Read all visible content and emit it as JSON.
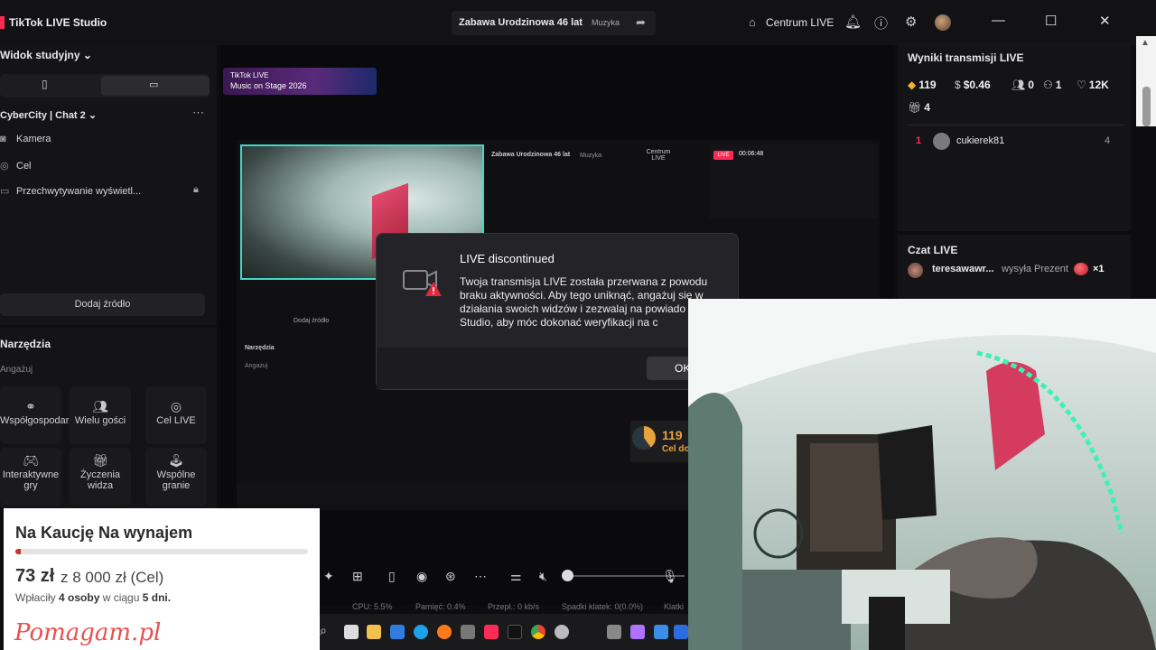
{
  "titlebar": {
    "app_title": "TikTok LIVE Studio",
    "stream_title": "Zabawa Urodzinowa 46 lat",
    "stream_category": "Muzyka",
    "centrum_live": "Centrum LIVE"
  },
  "left": {
    "studio_view": "Widok studyjny",
    "scene_name": "CyberCity | Chat 2",
    "sources": [
      {
        "label": "Kamera",
        "icon": "camera-icon"
      },
      {
        "label": "Cel",
        "icon": "target-icon"
      },
      {
        "label": "Przechwytywanie wyświetl...",
        "icon": "monitor-icon"
      }
    ],
    "add_source": "Dodaj źródło",
    "tools_title": "Narzędzia",
    "engage_label": "Angażuj",
    "tools": [
      {
        "label": "Współgospodarz",
        "icon": "link-icon"
      },
      {
        "label": "Wielu gości",
        "icon": "guests-icon"
      },
      {
        "label": "Cel LIVE",
        "icon": "target-icon"
      },
      {
        "label": "Interaktywne gry",
        "icon": "gamepad-icon"
      },
      {
        "label": "Życzenia widza",
        "icon": "gift-icon"
      },
      {
        "label": "Wspólne granie",
        "icon": "joystick-icon"
      }
    ]
  },
  "promo": {
    "line1": "TikTok LIVE",
    "line2": "Music on Stage 2026"
  },
  "nested": {
    "title": "Zabawa Urodzinowa 46 lat",
    "category": "Muzyka",
    "centrum": "Centrum LIVE",
    "timer": "00:06:48",
    "add_source": "Dodaj źródło",
    "tools": "Narzędzia",
    "engage": "Angażuj",
    "goal_value": "119",
    "goal_label": "Cel do"
  },
  "dialog": {
    "title": "LIVE discontinued",
    "body": "Twoja transmisja LIVE została przerwana z powodu braku aktywności. Aby tego uniknąć, angażuj się w działania swoich widzów i zezwalaj na powiado z LIVE Studio, aby móc dokonać weryfikacji na c",
    "ok": "OK"
  },
  "stats": {
    "cpu": "CPU: 5.5%",
    "memory": "Pamięć: 0.4%",
    "bitrate": "Przepł.: 0 kb/s",
    "frames": "Spadki klatek: 0(0.0%)",
    "more": "Klatki"
  },
  "results": {
    "title": "Wyniki transmisji LIVE",
    "diamonds": "119",
    "earnings": "$0.46",
    "viewers": "0",
    "new_followers": "1",
    "likes": "12K",
    "gifts": "4",
    "top_rank": "1",
    "top_user": "cukierek81",
    "top_count": "4"
  },
  "chat": {
    "title": "Czat LIVE",
    "user": "teresawawr...",
    "action": "wysyła Prezent",
    "multiplier": "×1"
  },
  "fundraiser": {
    "title": "Na Kaucję Na wynajem",
    "raised": "73 zł",
    "goal": "z 8 000 zł (Cel)",
    "support_prefix": "Wpłaciły",
    "supporters": "4 osoby",
    "support_mid": "w ciągu",
    "days": "5 dni.",
    "logo": "Pomagam.pl",
    "progress_fraction": 0.009
  },
  "colors": {
    "accent": "#fe2c55",
    "teal": "#43d7c8",
    "fund_logo": "#e8504e"
  }
}
